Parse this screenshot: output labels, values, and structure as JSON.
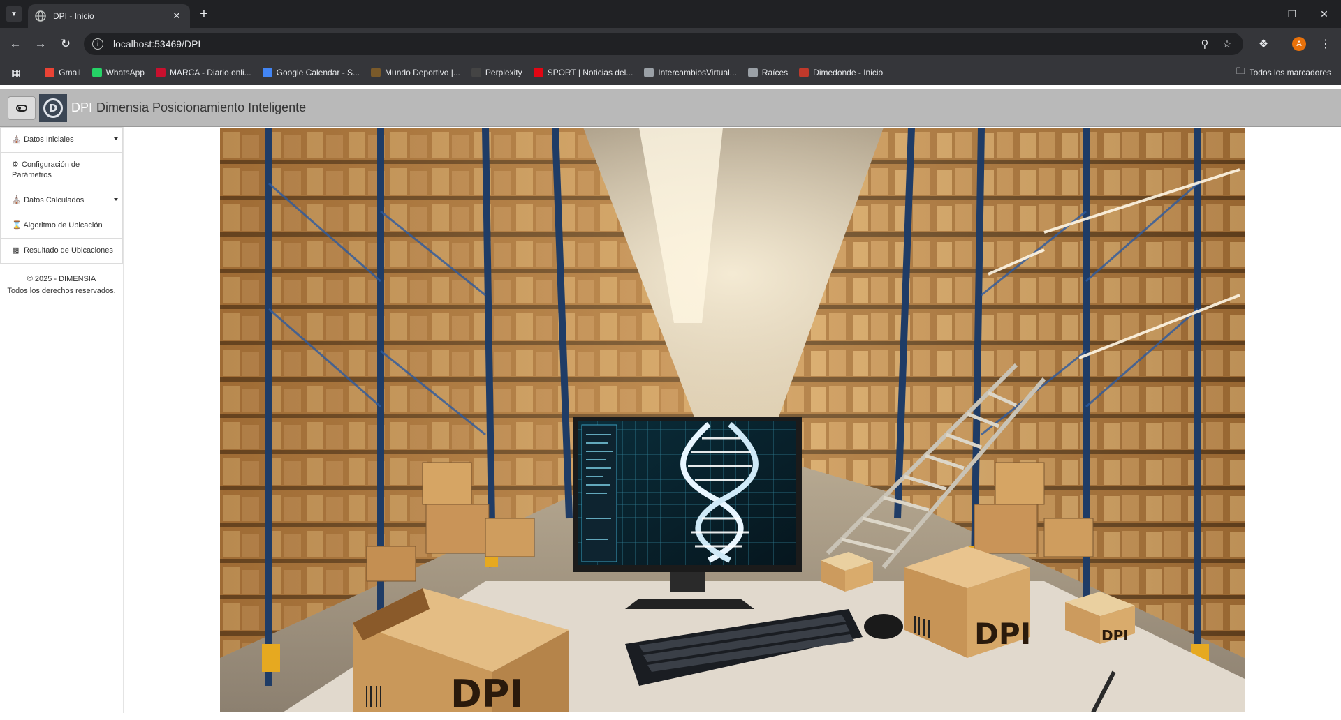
{
  "browser": {
    "tab_title": "DPI - Inicio",
    "url": "localhost:53469/DPI",
    "profile_initial": "A",
    "bookmarks": [
      {
        "label": "Gmail",
        "icon": "gmail-icon",
        "color": "#ea4335"
      },
      {
        "label": "WhatsApp",
        "icon": "whatsapp-icon",
        "color": "#25d366"
      },
      {
        "label": "MARCA - Diario onli...",
        "icon": "marca-icon",
        "color": "#c8102e"
      },
      {
        "label": "Google Calendar - S...",
        "icon": "calendar-icon",
        "color": "#4285f4"
      },
      {
        "label": "Mundo Deportivo |...",
        "icon": "mundo-deportivo-icon",
        "color": "#7a5a2a"
      },
      {
        "label": "Perplexity",
        "icon": "perplexity-icon",
        "color": "#444444"
      },
      {
        "label": "SPORT | Noticias del...",
        "icon": "sport-icon",
        "color": "#e30613"
      },
      {
        "label": "IntercambiosVirtual...",
        "icon": "globe-icon",
        "color": "#9aa0a6"
      },
      {
        "label": "Raíces",
        "icon": "globe-icon",
        "color": "#9aa0a6"
      },
      {
        "label": "Dimedonde - Inicio",
        "icon": "dimedonde-icon",
        "color": "#c0392b"
      }
    ],
    "all_bookmarks": "Todos los marcadores"
  },
  "app": {
    "brand_abbr": "DPI",
    "brand_name": "Dimensia Posicionamiento Inteligente",
    "logo_letter": "D"
  },
  "sidebar": {
    "items": [
      {
        "label": "Datos Iniciales",
        "icon": "building-icon",
        "has_caret": true
      },
      {
        "label": "Configuración de Parámetros",
        "icon": "gears-icon",
        "has_caret": false
      },
      {
        "label": "Datos Calculados",
        "icon": "building-icon",
        "has_caret": true
      },
      {
        "label": "Algoritmo de Ubicación",
        "icon": "hourglass-icon",
        "has_caret": false
      },
      {
        "label": "Resultado de Ubicaciones",
        "icon": "report-icon",
        "has_caret": false
      }
    ],
    "footer_line1": "© 2025 - DIMENSIA",
    "footer_line2": "Todos los derechos reservados."
  },
  "hero": {
    "box_text_1": "DPI",
    "box_text_2": "DPI",
    "box_text_3": "DPI"
  },
  "colors": {
    "appbar": "#b9b9b9",
    "chrome_dark": "#202124",
    "chrome_mid": "#35363a"
  }
}
